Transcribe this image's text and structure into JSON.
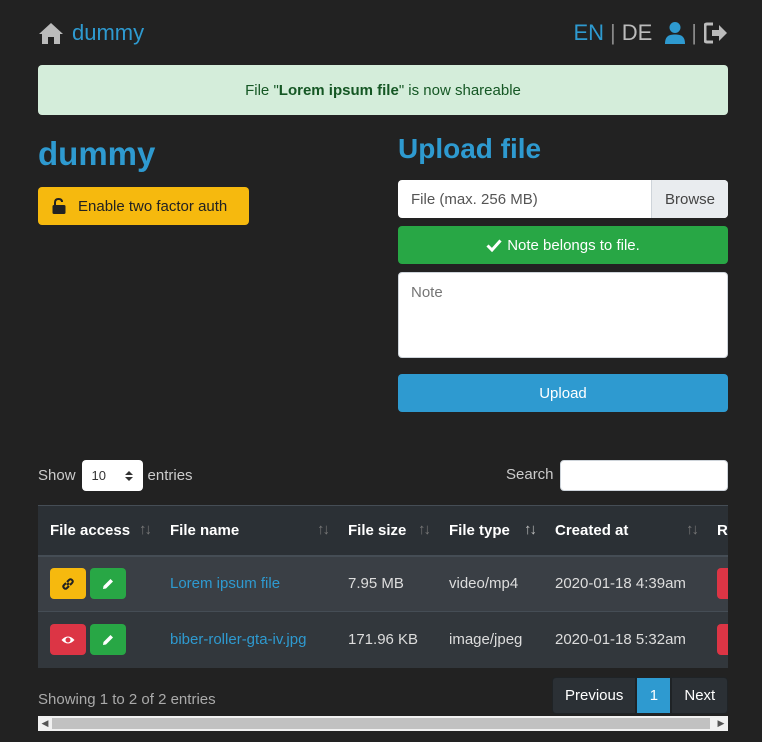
{
  "header": {
    "brand": "dummy",
    "lang_en": "EN",
    "lang_sep": "|",
    "lang_de": "DE"
  },
  "alert": {
    "prefix": "File \"",
    "file": "Lorem ipsum file",
    "suffix": "\" is now shareable"
  },
  "user": {
    "name": "dummy",
    "twofa_label": "Enable two factor auth"
  },
  "upload": {
    "title": "Upload file",
    "file_placeholder": "File (max. 256 MB)",
    "browse_label": "Browse",
    "note_ok": "Note belongs to file.",
    "note_placeholder": "Note",
    "upload_label": "Upload"
  },
  "table_controls": {
    "show": "Show",
    "entries_value": "10",
    "entries": "entries",
    "search": "Search"
  },
  "table": {
    "headers": [
      "File access",
      "File name",
      "File size",
      "File type",
      "Created at",
      "R"
    ],
    "rows": [
      {
        "access": "link",
        "name": "Lorem ipsum file",
        "size": "7.95 MB",
        "type": "video/mp4",
        "created": "2020-01-18 4:39am"
      },
      {
        "access": "eye",
        "name": "biber-roller-gta-iv.jpg",
        "size": "171.96 KB",
        "type": "image/jpeg",
        "created": "2020-01-18 5:32am"
      }
    ]
  },
  "footer": {
    "info": "Showing 1 to 2 of 2 entries",
    "prev": "Previous",
    "page": "1",
    "next": "Next"
  },
  "colors": {
    "accent": "#2e9ad0",
    "warning": "#f6b90e",
    "success": "#28a745",
    "danger": "#dc3545",
    "background": "#222222"
  },
  "icons": [
    "home-icon",
    "user-icon",
    "logout-icon",
    "unlock-icon",
    "check-icon",
    "link-icon",
    "eye-icon",
    "pencil-icon",
    "sort-icon"
  ]
}
